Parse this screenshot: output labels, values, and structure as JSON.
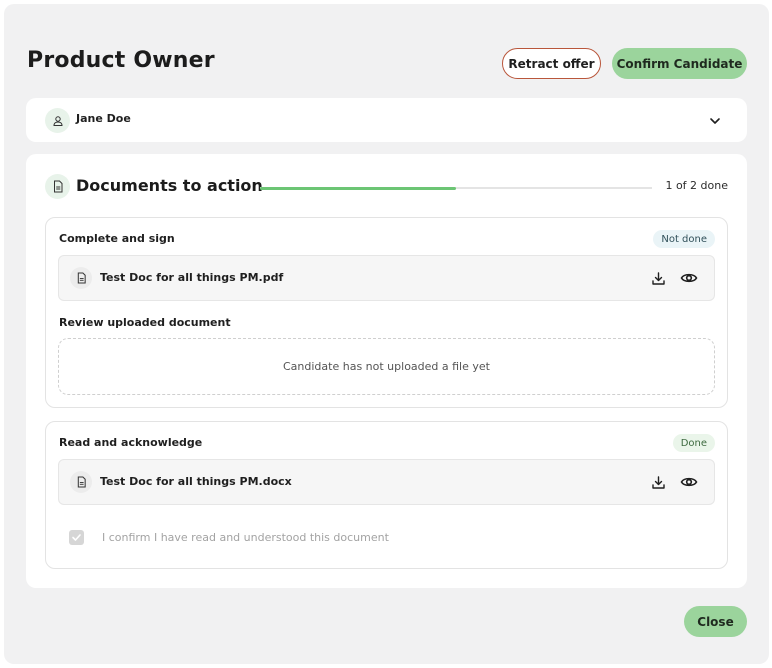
{
  "header": {
    "title": "Product Owner",
    "retract_label": "Retract offer",
    "confirm_label": "Confirm Candidate"
  },
  "candidate": {
    "name": "Jane Doe",
    "avatar_icon": "person-icon",
    "expand_icon": "chevron-down-icon"
  },
  "documents": {
    "title": "Documents to action",
    "progress_fraction": 0.5,
    "progress_text": "1 of 2 done",
    "sections": [
      {
        "title": "Complete and sign",
        "status": "Not done",
        "file": "Test Doc for all things PM.pdf",
        "review_title": "Review uploaded document",
        "upload_placeholder": "Candidate has not uploaded a file yet"
      },
      {
        "title": "Read and acknowledge",
        "status": "Done",
        "file": "Test Doc for all things PM.docx",
        "acknowledge_text": "I confirm I have read and understood this document",
        "acknowledged": true
      }
    ]
  },
  "footer": {
    "close_label": "Close"
  },
  "colors": {
    "accent_green": "#9bd49c",
    "progress_green": "#6cc574",
    "retract_border": "#b9563b",
    "background": "#f1f1f2"
  }
}
